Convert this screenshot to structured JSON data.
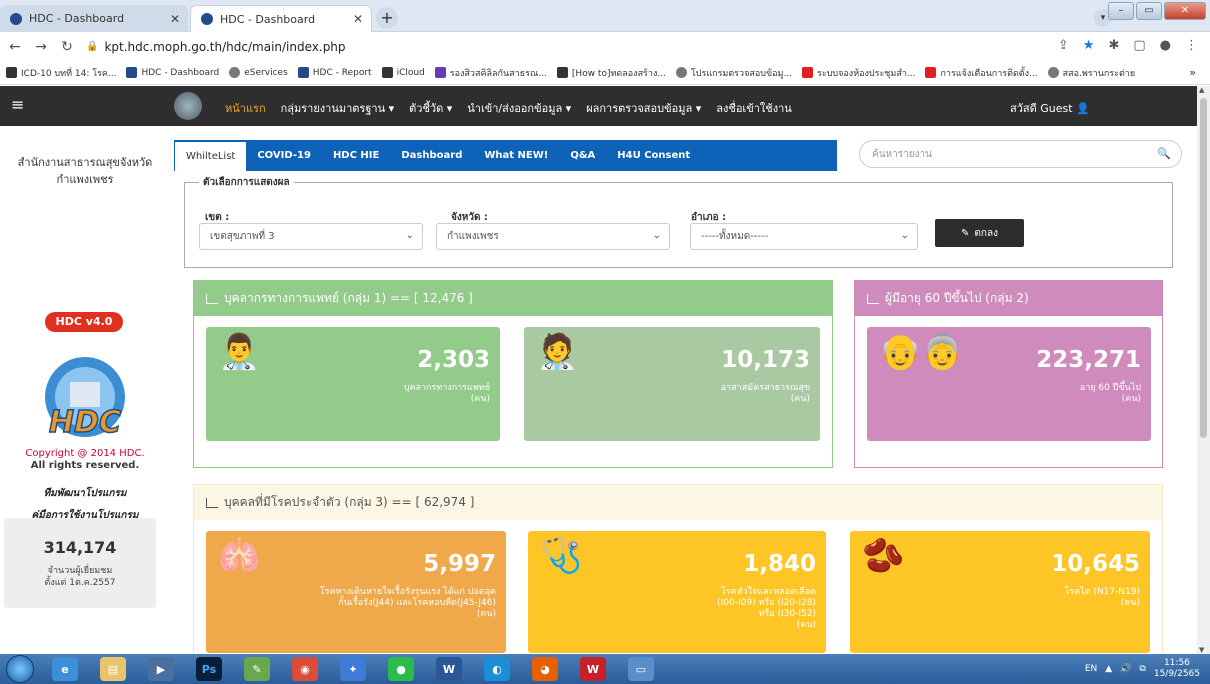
{
  "browser": {
    "tabs": [
      {
        "title": "HDC - Dashboard"
      },
      {
        "title": "HDC - Dashboard"
      }
    ],
    "url": "kpt.hdc.moph.go.th/hdc/main/index.php",
    "bookmarks": [
      "ICD-10 บทที่ 14: โรค...",
      "HDC - Dashboard",
      "eServices",
      "HDC - Report",
      "iCloud",
      "รองสิวสคิลิลกันสาธรณ...",
      "[How to]ทดลองสร้าง...",
      "โปรแกรมตรวจสอบข้อมู...",
      "ระบบจองห้องประชุมสำ...",
      "การแจ้งเตือนการติดตั้ง...",
      "สสอ.พรานกระต่าย"
    ]
  },
  "nav": {
    "items": [
      "หน้าแรก",
      "กลุ่มรายงานมาตรฐาน ▾",
      "ตัวชี้วัด ▾",
      "นำเข้า/ส่งออกข้อมูล ▾",
      "ผลการตรวจสอบข้อมูล ▾",
      "ลงชื่อเข้าใช้งาน"
    ],
    "greeting": "สวัสดี Guest"
  },
  "sidebar": {
    "org_line1": "สำนักงานสาธารณสุขจังหวัด",
    "org_line2": "กำแพงเพชร",
    "badge": "HDC v4.0",
    "logo_text": "HDC",
    "copyright_line1": "Copyright @ 2014 HDC.",
    "copyright_line2": "All rights reserved.",
    "link_team": "ทีมพัฒนาโปรแกรม",
    "link_manual": "คู่มือการใช้งานโปรแกรม",
    "visitors": "314,174",
    "visitors_label_1": "จำนวนผู้เยี่ยมชม",
    "visitors_label_2": "ตั้งแต่ 1ต.ค.2557"
  },
  "content_tabs": [
    "WhilteList",
    "COVID-19",
    "HDC HIE",
    "Dashboard",
    "What NEW!",
    "Q&A",
    "H4U Consent"
  ],
  "search": {
    "placeholder": "ค้นหารายงาน"
  },
  "filter": {
    "legend": "ตัวเลือกการแสดงผล",
    "zone_label": "เขต :",
    "zone_value": "เขตสุขภาพที่ 3",
    "province_label": "จังหวัด :",
    "province_value": "กำแพงเพชร",
    "district_label": "อำเภอ :",
    "district_value": "-----ทั้งหมด-----",
    "ok_label": "ตกลง"
  },
  "group1": {
    "title": "บุคลากรทางการแพทย์ (กลุ่ม 1) == [ 12,476 ]",
    "cards": [
      {
        "value": "2,303",
        "label1": "บุคลากรทางการแพทย์",
        "label2": "(คน)"
      },
      {
        "value": "10,173",
        "label1": "อาสาสมัครสาธารณสุข",
        "label2": "(คน)"
      }
    ]
  },
  "group2": {
    "title": "ผู้มีอายุ 60 ปีขึ้นไป (กลุ่ม 2)",
    "card": {
      "value": "223,271",
      "label1": "อายุ 60 ปีขึ้นไป",
      "label2": "(คน)"
    }
  },
  "group3": {
    "title": "บุคคลที่มีโรคประจำตัว (กลุ่ม 3) == [ 62,974 ]",
    "cards": [
      {
        "value": "5,997",
        "label1": "โรคทางเดินหายใจเรื้อรังรุนแรง ได้แก่ ปอดอุด",
        "label2": "กั้นเรื้อรัง(J44) และโรคหอบหืด(J45-J46)",
        "label3": "(คน)"
      },
      {
        "value": "1,840",
        "label1": "โรคหัวใจและหลอดเลือด",
        "label2": "(I00-I09) หรือ (I20-I28)",
        "label3": "หรือ (I30-I52)",
        "label4": "(คน)"
      },
      {
        "value": "10,645",
        "label1": "โรคไต (N17-N19)",
        "label2": "(คน)"
      }
    ]
  },
  "taskbar": {
    "lang": "EN",
    "time": "11:56",
    "date": "15/9/2565"
  },
  "colors": {
    "green": "#92cb8a",
    "purple": "#cf8bbb",
    "orange": "#efa84a",
    "yellow": "#fdc526",
    "nav": "#2e2e2e",
    "tabs": "#0e62b7"
  }
}
